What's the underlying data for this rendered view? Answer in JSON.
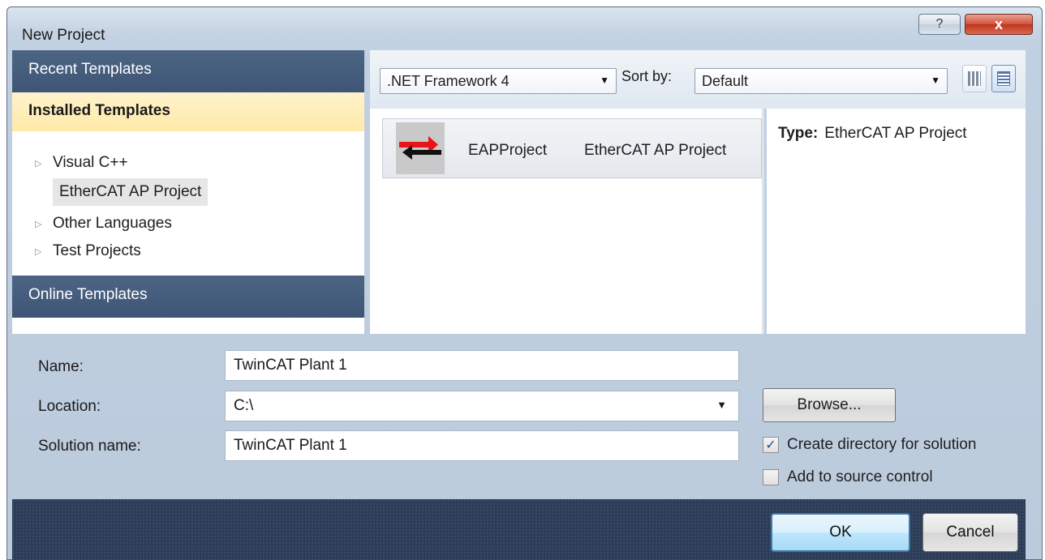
{
  "window": {
    "title": "New Project",
    "help_label": "?",
    "close_label": "x"
  },
  "left": {
    "recent": "Recent Templates",
    "installed": "Installed Templates",
    "tree": [
      {
        "label": "Visual C++",
        "expandable": true
      },
      {
        "label": "EtherCAT AP Project",
        "expandable": false,
        "selected": true
      },
      {
        "label": "Other Languages",
        "expandable": true
      },
      {
        "label": "Test Projects",
        "expandable": true
      }
    ],
    "online": "Online Templates"
  },
  "toolbar": {
    "framework": ".NET Framework 4",
    "sort_label": "Sort by:",
    "sort_value": "Default"
  },
  "templates": [
    {
      "name": "EAPProject",
      "type": "EtherCAT AP Project"
    }
  ],
  "detail": {
    "type_label": "Type:",
    "type_value": "EtherCAT AP Project"
  },
  "form": {
    "name_label": "Name:",
    "name_value": "TwinCAT Plant 1",
    "location_label": "Location:",
    "location_value": "C:\\",
    "solution_label": "Solution name:",
    "solution_value": "TwinCAT Plant 1",
    "browse": "Browse...",
    "create_dir": "Create directory for solution",
    "create_dir_checked": true,
    "source_control": "Add to source control",
    "source_control_checked": false
  },
  "buttons": {
    "ok": "OK",
    "cancel": "Cancel"
  },
  "colors": {
    "section_header": "#45607f",
    "selected_section": "#ffedb5",
    "bottom_bar": "#2d3d57",
    "close_button": "#c83b24"
  }
}
